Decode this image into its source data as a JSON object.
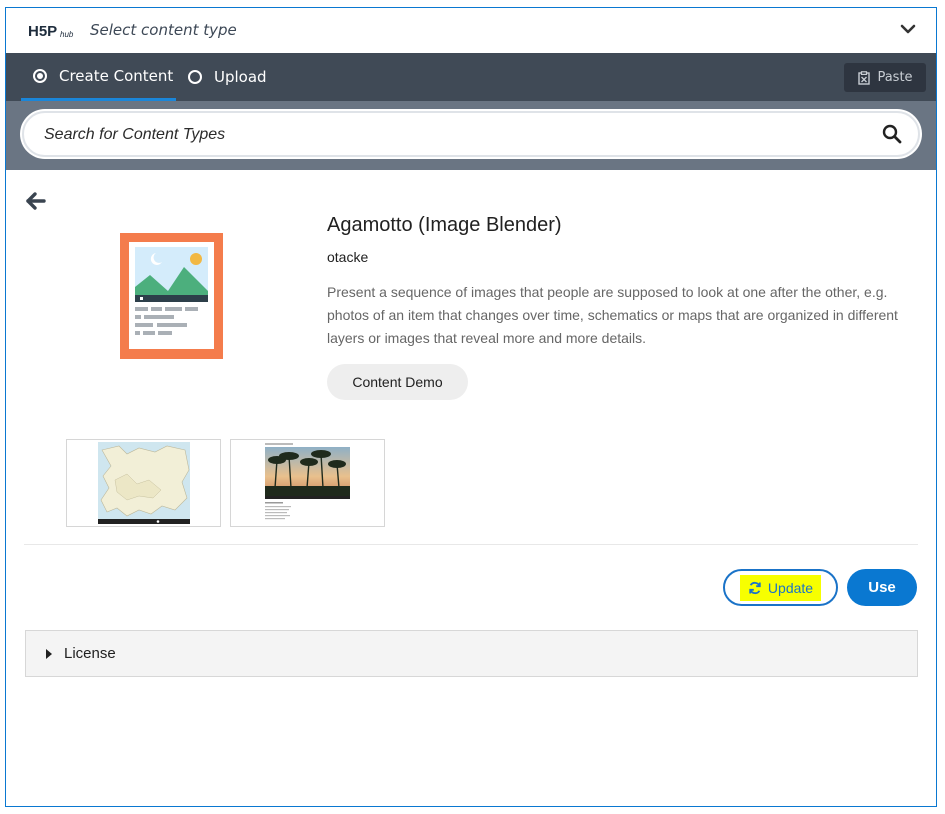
{
  "header": {
    "logo_text": "H5P hub",
    "title": "Select content type",
    "toggle_icon": "chevron-down-icon"
  },
  "tabs": [
    {
      "label": "Create Content",
      "selected": true
    },
    {
      "label": "Upload",
      "selected": false
    }
  ],
  "paste": {
    "label": "Paste",
    "icon": "clipboard-icon"
  },
  "search": {
    "placeholder": "Search for Content Types",
    "value": "",
    "icon": "search-icon"
  },
  "detail": {
    "back_icon": "arrow-left-icon",
    "title": "Agamotto (Image Blender)",
    "owner": "otacke",
    "description": "Present a sequence of images that people are supposed to look at one after the other, e.g. photos of an item that changes over time, schematics or maps that are organized in different layers or images that reveal more and more details.",
    "demo_label": "Content Demo",
    "screenshots": [
      {
        "name": "map-of-europe-screenshot",
        "caption": ""
      },
      {
        "name": "palm-trees-screenshot",
        "caption": ""
      }
    ]
  },
  "actions": {
    "update_label": "Update",
    "update_icon": "refresh-icon",
    "use_label": "Use"
  },
  "license": {
    "label": "License"
  },
  "colors": {
    "accent": "#0a78d1",
    "tab_bar": "#404a56",
    "search_band": "#6a7583",
    "icon_orange": "#f47c4c",
    "highlight": "#f7ff00"
  }
}
